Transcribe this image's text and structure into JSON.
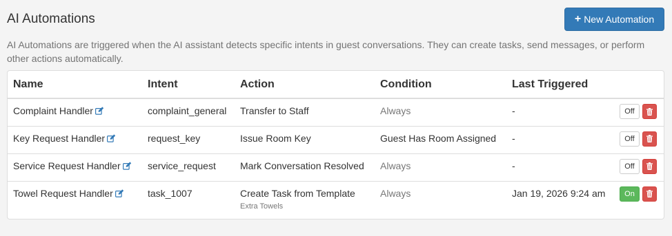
{
  "header": {
    "title": "AI Automations",
    "new_button_label": "New Automation",
    "new_button_icon": "plus-icon",
    "description": "AI Automations are triggered when the AI assistant detects specific intents in guest conversations. They can create tasks, send messages, or perform other actions automatically."
  },
  "table": {
    "columns": [
      "Name",
      "Intent",
      "Action",
      "Condition",
      "Last Triggered"
    ],
    "rows": [
      {
        "name": "Complaint Handler",
        "intent": "complaint_general",
        "action": "Transfer to Staff",
        "action_detail": "",
        "condition": "Always",
        "last_triggered": "-",
        "toggle": "Off"
      },
      {
        "name": "Key Request Handler",
        "intent": "request_key",
        "action": "Issue Room Key",
        "action_detail": "",
        "condition": "Guest Has Room Assigned",
        "last_triggered": "-",
        "toggle": "Off"
      },
      {
        "name": "Service Request Handler",
        "intent": "service_request",
        "action": "Mark Conversation Resolved",
        "action_detail": "",
        "condition": "Always",
        "last_triggered": "-",
        "toggle": "Off"
      },
      {
        "name": "Towel Request Handler",
        "intent": "task_1007",
        "action": "Create Task from Template",
        "action_detail": "Extra Towels",
        "condition": "Always",
        "last_triggered": "Jan 19, 2026 9:24 am",
        "toggle": "On"
      }
    ]
  },
  "colors": {
    "primary": "#337ab7",
    "success": "#5cb85c",
    "danger": "#d9534f",
    "muted_text": "#777777"
  }
}
